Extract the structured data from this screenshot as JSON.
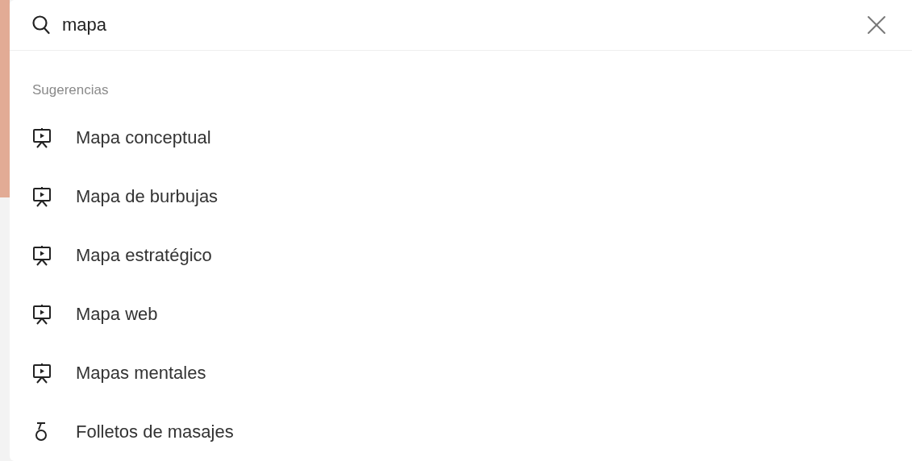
{
  "search": {
    "value": "mapa"
  },
  "suggestions_heading": "Sugerencias",
  "suggestions": [
    {
      "kind": "presentation",
      "label": "Mapa conceptual"
    },
    {
      "kind": "presentation",
      "label": "Mapa de burbujas"
    },
    {
      "kind": "presentation",
      "label": "Mapa estratégico"
    },
    {
      "kind": "presentation",
      "label": "Mapa web"
    },
    {
      "kind": "presentation",
      "label": "Mapas mentales"
    },
    {
      "kind": "massage",
      "label": "Folletos de masajes"
    }
  ]
}
